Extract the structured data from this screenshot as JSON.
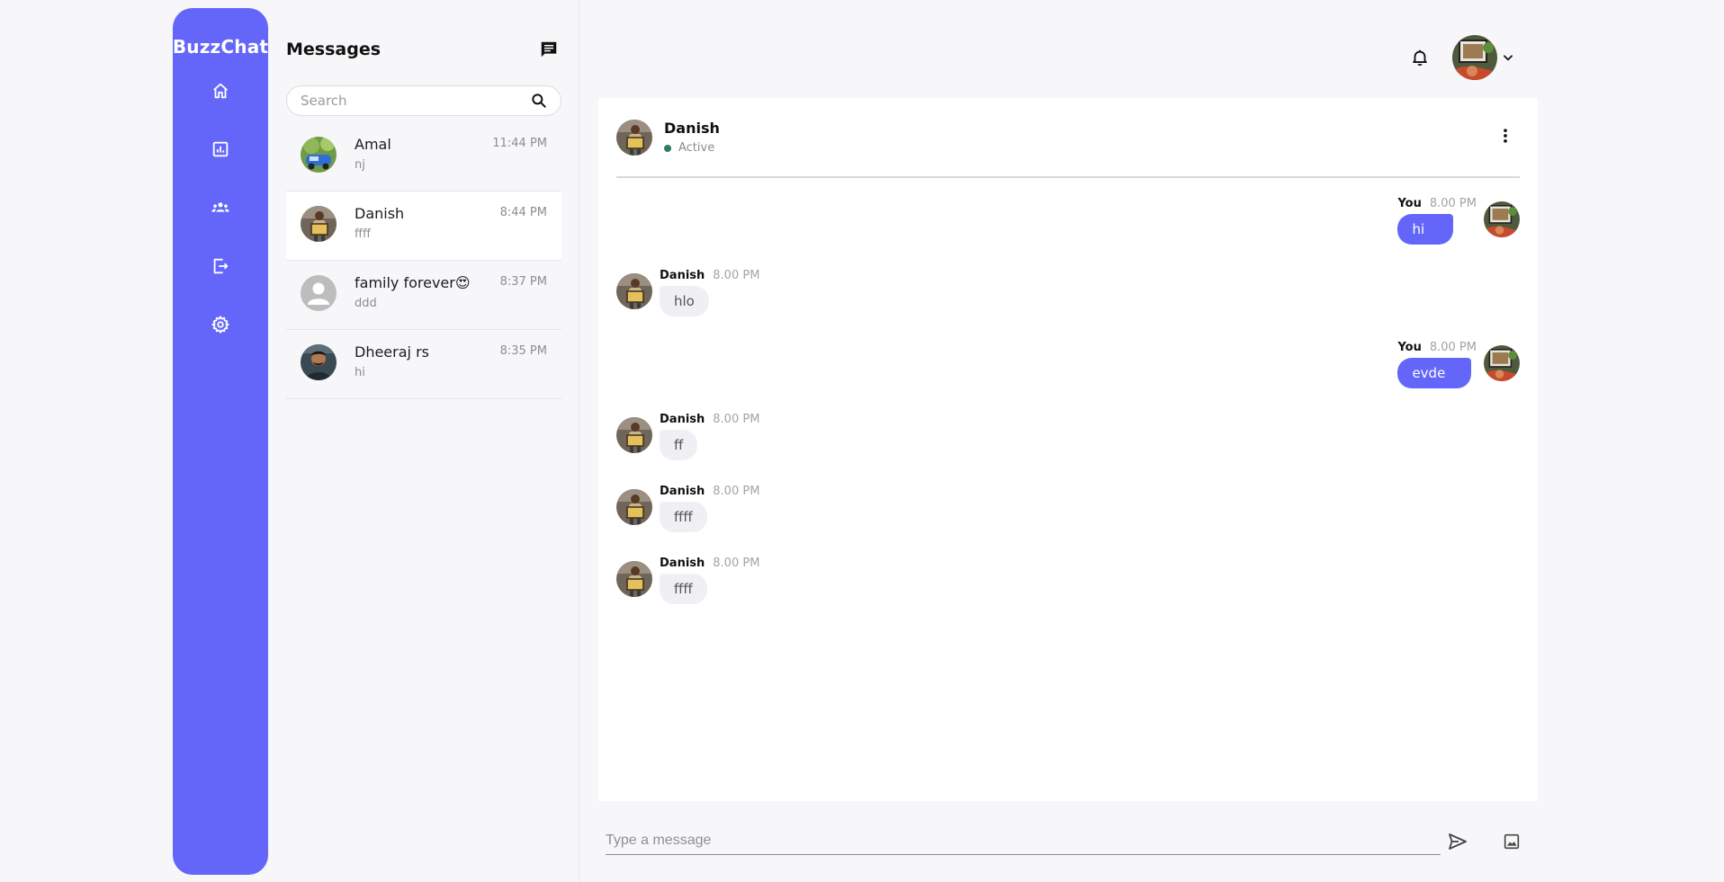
{
  "brand": {
    "name": "BuzzChat"
  },
  "nav": {
    "items": [
      {
        "icon": "home-icon"
      },
      {
        "icon": "analytics-icon"
      },
      {
        "icon": "groups-icon"
      },
      {
        "icon": "logout-icon"
      },
      {
        "icon": "settings-icon"
      }
    ]
  },
  "messages_panel": {
    "title": "Messages",
    "compose_icon": "chat-bubble-icon",
    "search": {
      "placeholder": "Search",
      "value": ""
    }
  },
  "conversations": [
    {
      "name": "Amal",
      "preview": "nj",
      "time": "11:44 PM",
      "active": false
    },
    {
      "name": "Danish",
      "preview": "ffff",
      "time": "8:44 PM",
      "active": true
    },
    {
      "name": "family forever😍",
      "preview": "ddd",
      "time": "8:37 PM",
      "active": false
    },
    {
      "name": "Dheeraj rs",
      "preview": "hi",
      "time": "8:35 PM",
      "active": false
    }
  ],
  "chat": {
    "contact_name": "Danish",
    "status": "Active",
    "messages": [
      {
        "sender": "You",
        "time": "8.00 PM",
        "text": "hi",
        "direction": "out"
      },
      {
        "sender": "Danish",
        "time": "8.00 PM",
        "text": "hlo",
        "direction": "in"
      },
      {
        "sender": "You",
        "time": "8.00 PM",
        "text": "evde",
        "direction": "out"
      },
      {
        "sender": "Danish",
        "time": "8.00 PM",
        "text": "ff",
        "direction": "in"
      },
      {
        "sender": "Danish",
        "time": "8.00 PM",
        "text": "ffff",
        "direction": "in"
      },
      {
        "sender": "Danish",
        "time": "8.00 PM",
        "text": "ffff",
        "direction": "in"
      }
    ]
  },
  "composer": {
    "placeholder": "Type a message",
    "value": ""
  },
  "colors": {
    "accent": "#6366f9",
    "status_active": "#2e7d5b"
  }
}
